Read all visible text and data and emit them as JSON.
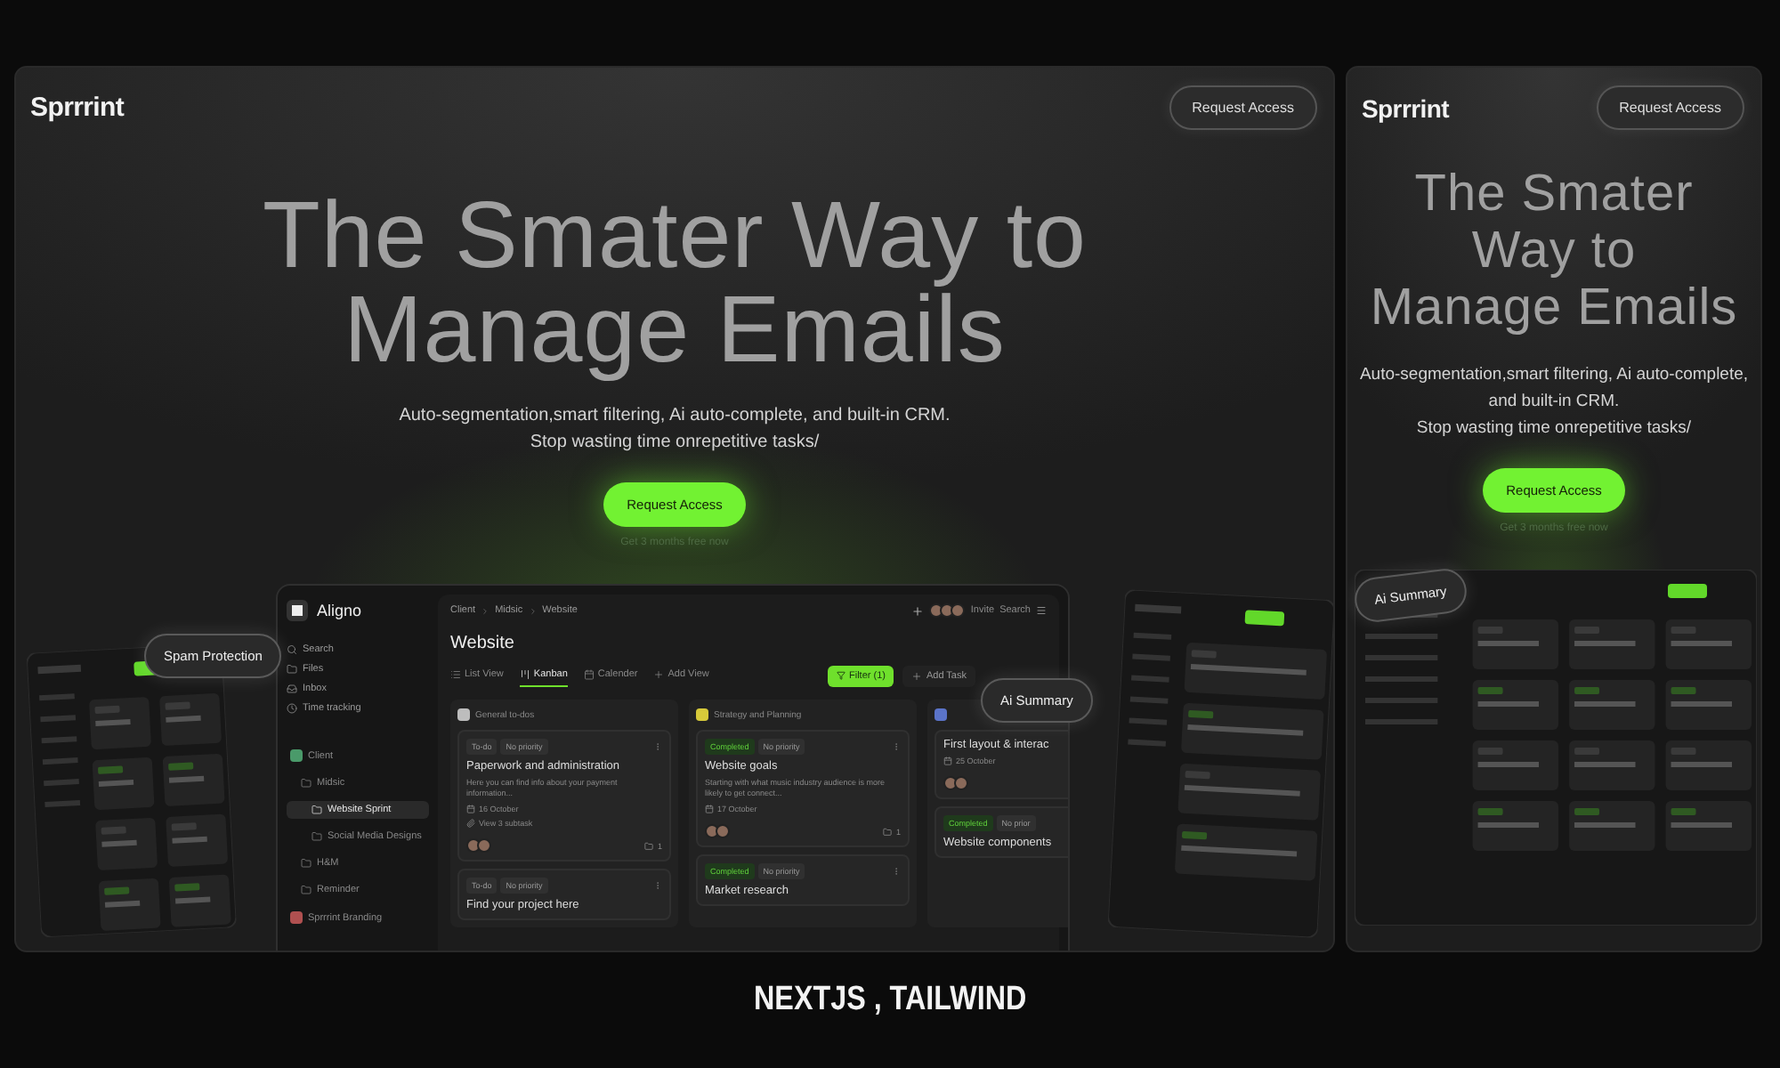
{
  "desktop": {
    "logo": "Sprrrint",
    "header_button": "Request Access",
    "title_lines": [
      "The Smater Way to",
      "Manage Emails"
    ],
    "subtitle_lines": [
      "Auto-segmentation,smart filtering, Ai auto-complete, and built-in CRM.",
      "Stop wasting time onrepetitive tasks/"
    ],
    "cta": "Request Access",
    "cta_note": "Get 3 months free now",
    "floating_labels": [
      "Spam Protection",
      "Ai Summary"
    ],
    "app": {
      "brand": "Aligno",
      "nav": [
        "Search",
        "Files",
        "Inbox",
        "Time tracking"
      ],
      "spaces": [
        {
          "label": "Client",
          "selected": false,
          "color": "#4a9a6a",
          "children": [
            {
              "label": "Midsic",
              "selected": false,
              "children": [
                {
                  "label": "Website Sprint",
                  "selected": true
                },
                {
                  "label": "Social Media Designs",
                  "selected": false
                }
              ]
            },
            {
              "label": "H&M",
              "selected": false
            },
            {
              "label": "Reminder",
              "selected": false
            }
          ]
        },
        {
          "label": "Sprrrint Branding",
          "selected": false,
          "color": "#b05050"
        }
      ],
      "breadcrumb": [
        "Client",
        "Midsic",
        "Website"
      ],
      "header_actions": [
        "Invite",
        "Search"
      ],
      "page_title": "Website",
      "tabs": [
        {
          "label": "List View",
          "kind": "view",
          "selected": false
        },
        {
          "label": "Kanban",
          "kind": "view",
          "selected": true
        },
        {
          "label": "Calender",
          "kind": "view",
          "selected": false
        },
        {
          "label": "Add View",
          "kind": "add",
          "selected": false
        }
      ],
      "filter_button": "Filter (1)",
      "add_button": "Add Task",
      "columns": [
        {
          "name": "General to-dos",
          "color": "#bdbdbd",
          "cards": [
            {
              "status": {
                "label": "To-do",
                "kind": "todo"
              },
              "priority": "No priority",
              "title": "Paperwork and administration",
              "description": "Here you can find info about your payment information...",
              "date": "16 October",
              "subtasks": "View 3 subtask",
              "count": "1"
            },
            {
              "status": {
                "label": "To-do",
                "kind": "todo"
              },
              "priority": "No priority",
              "title": "Find your project here"
            }
          ]
        },
        {
          "name": "Strategy and Planning",
          "color": "#d6c93a",
          "cards": [
            {
              "status": {
                "label": "Completed",
                "kind": "done"
              },
              "priority": "No priority",
              "title": "Website goals",
              "description": "Starting with what music industry audience is more likely to get connect...",
              "date": "17 October",
              "count": "1"
            },
            {
              "status": {
                "label": "Completed",
                "kind": "done"
              },
              "priority": "No priority",
              "title": "Market research"
            }
          ]
        },
        {
          "color": "#5b74c9",
          "cards": [
            {
              "title": "First layout & interac",
              "date": "25 October"
            },
            {
              "status": {
                "label": "Completed",
                "kind": "done"
              },
              "priority": "No prior",
              "title": "Website components"
            }
          ]
        }
      ]
    }
  },
  "mobile": {
    "logo": "Sprrrint",
    "header_button": "Request Access",
    "title_lines": [
      "The Smater",
      "Way to",
      "Manage Emails"
    ],
    "subtitle_lines": [
      "Auto-segmentation,smart filtering, Ai auto-complete,",
      "and built-in CRM.",
      "Stop wasting time onrepetitive tasks/"
    ],
    "cta": "Request Access",
    "cta_note": "Get 3 months free now",
    "floating_label": "Ai Summary"
  },
  "caption": "NEXTJS , TAILWIND"
}
